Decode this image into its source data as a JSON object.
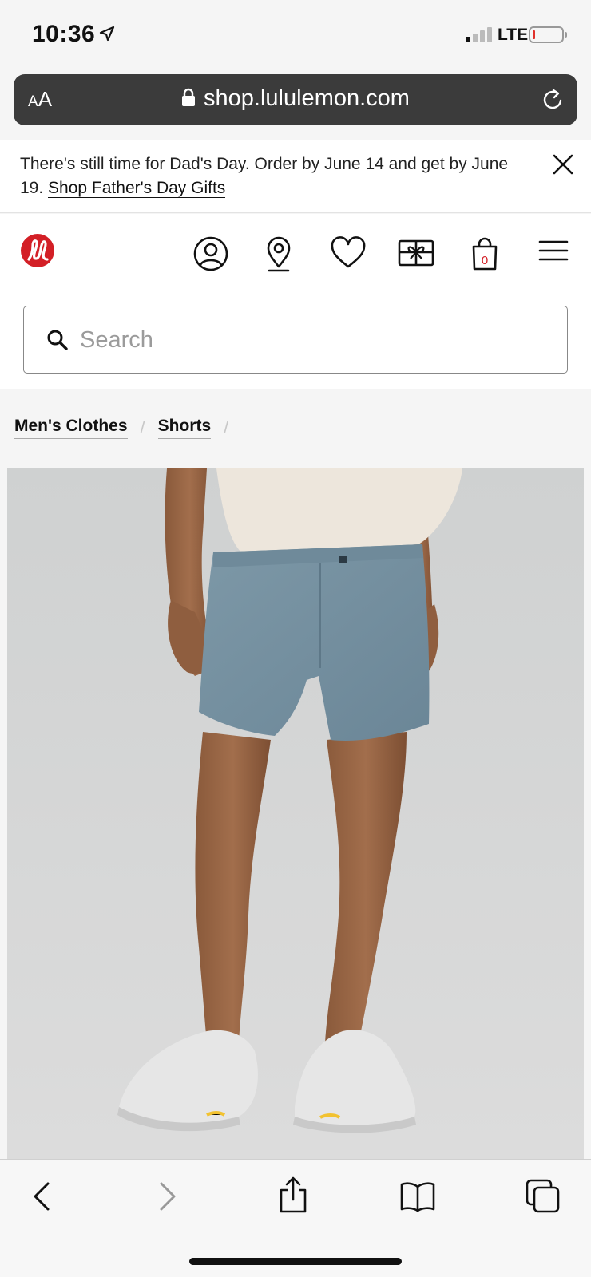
{
  "status_bar": {
    "time": "10:36",
    "network": "LTE",
    "battery_color": "#e0312b"
  },
  "browser": {
    "text_size_label_small": "A",
    "text_size_label_large": "A",
    "url": "shop.lululemon.com"
  },
  "promo": {
    "message": "There's still time for Dad's Day. Order by June 14 and get by June 19.",
    "link": "Shop Father's Day Gifts"
  },
  "header": {
    "bag_count": "0",
    "brand_color": "#d31f26",
    "icons": [
      "account-icon",
      "store-locator-icon",
      "wishlist-icon",
      "gift-card-icon",
      "shopping-bag-icon",
      "menu-icon"
    ]
  },
  "search": {
    "placeholder": "Search",
    "value": ""
  },
  "breadcrumb": [
    {
      "label": "Men's Clothes"
    },
    {
      "label": "Shorts"
    }
  ],
  "toolbar": {
    "icons": [
      "back-icon",
      "forward-icon",
      "share-icon",
      "bookmarks-icon",
      "tabs-icon"
    ]
  }
}
